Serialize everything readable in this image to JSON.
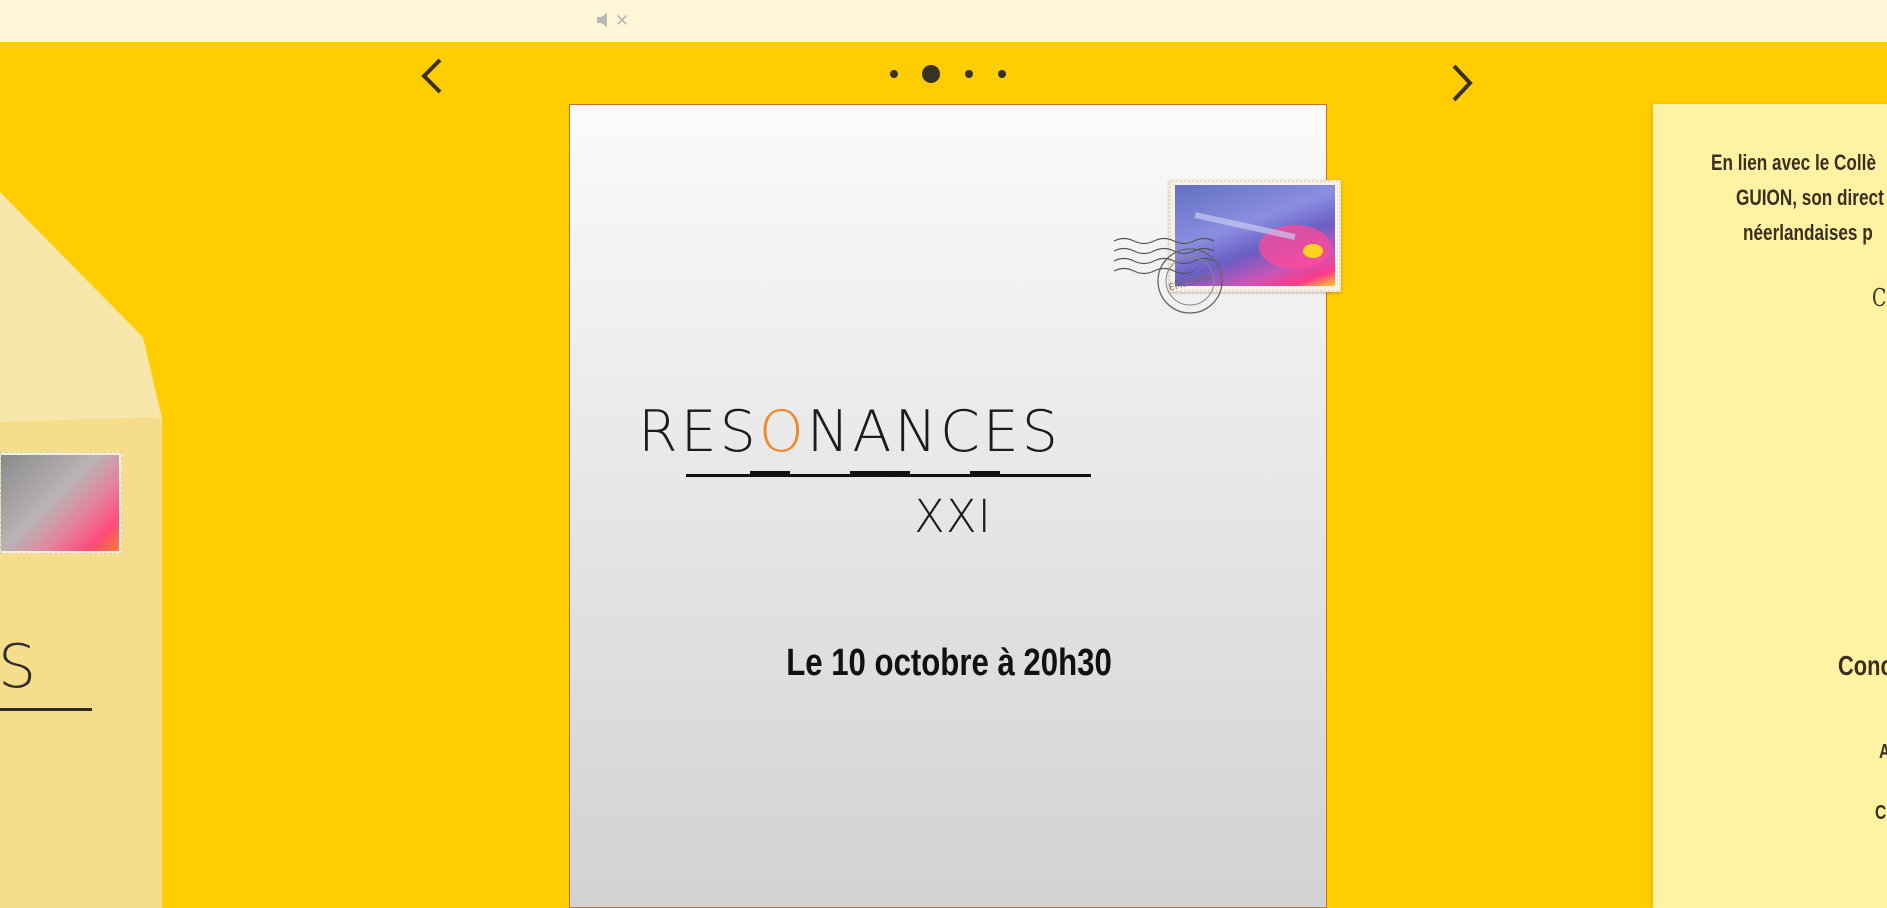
{
  "top_bar": {
    "mute_icon": "speaker-mute-icon",
    "mute_glyph": "✕"
  },
  "navigation": {
    "prev_icon": "chevron-left-icon",
    "next_icon": "chevron-right-icon",
    "pagination": {
      "total": 4,
      "active_index": 1
    }
  },
  "left_card": {
    "title_fragment": "S"
  },
  "main_card": {
    "stamp_icon": "violin-stamp-image",
    "postmark_text": "ÉMÉOSTA",
    "title_prefix": "RES",
    "title_accent": "O",
    "title_suffix": "NANCES",
    "subtitle": "XXI",
    "date": "Le 10 octobre à 20h30"
  },
  "right_card": {
    "line1": "En lien avec le Collè",
    "line2": "GUION, son direct",
    "line3": "néerlandaises p",
    "line4": "C",
    "line5": "Conc",
    "line6": "A",
    "line7": "Ci"
  },
  "colors": {
    "background": "#ffcd00",
    "top_bar": "#fff6d8",
    "accent_orange": "#ef8a2c",
    "right_card": "#fff2a3"
  }
}
